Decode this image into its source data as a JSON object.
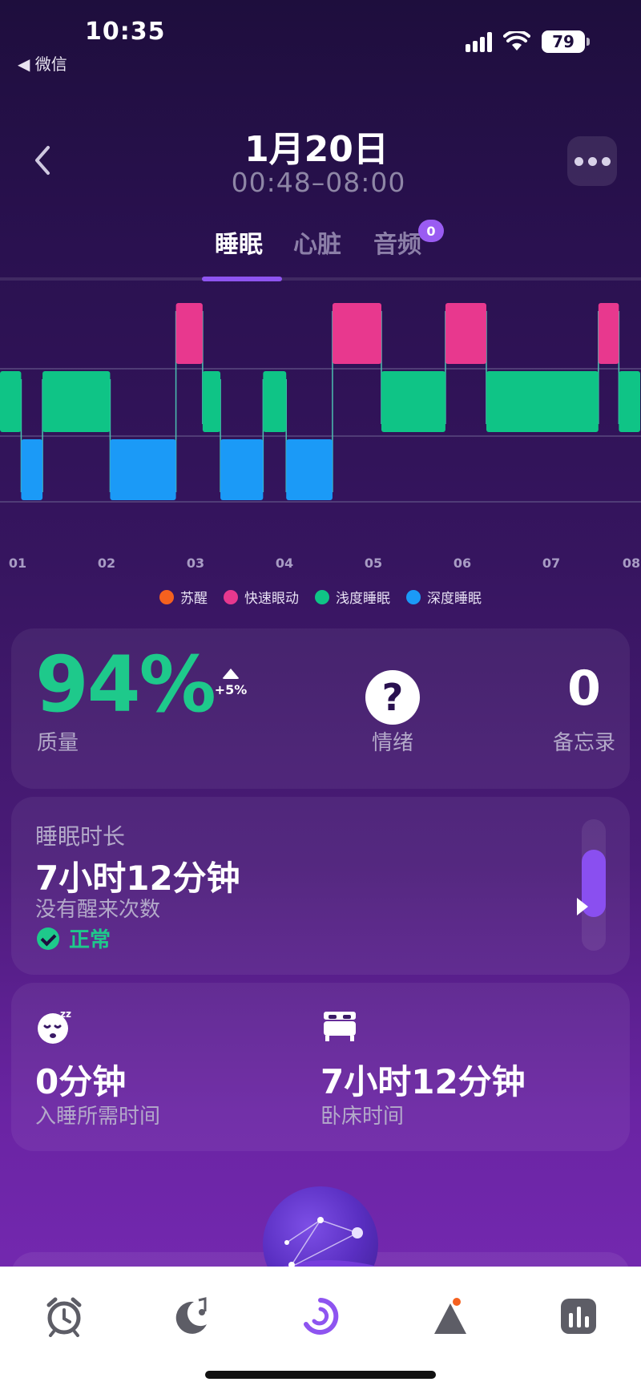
{
  "status_bar": {
    "time": "10:35",
    "back_app": "◀ 微信",
    "battery": "79"
  },
  "header": {
    "title": "1月20日",
    "subtitle": "00:48–08:00"
  },
  "tabs": [
    {
      "label": "睡眠",
      "active": true
    },
    {
      "label": "心脏",
      "active": false
    },
    {
      "label": "音频",
      "active": false,
      "badge": "0"
    }
  ],
  "chart_data": {
    "type": "hypnogram",
    "x_ticks": [
      "01",
      "02",
      "03",
      "04",
      "05",
      "06",
      "07",
      "08"
    ],
    "x_range_hours": [
      0.8,
      8.0
    ],
    "stages": [
      "rem",
      "light",
      "deep"
    ],
    "segments": [
      {
        "stage": "light",
        "start": 0.8,
        "end": 1.04
      },
      {
        "stage": "deep",
        "start": 1.04,
        "end": 1.28
      },
      {
        "stage": "light",
        "start": 1.28,
        "end": 2.04
      },
      {
        "stage": "deep",
        "start": 2.04,
        "end": 2.78
      },
      {
        "stage": "rem",
        "start": 2.78,
        "end": 3.08
      },
      {
        "stage": "light",
        "start": 3.08,
        "end": 3.28
      },
      {
        "stage": "deep",
        "start": 3.28,
        "end": 3.76
      },
      {
        "stage": "light",
        "start": 3.76,
        "end": 4.02
      },
      {
        "stage": "deep",
        "start": 4.02,
        "end": 4.54
      },
      {
        "stage": "rem",
        "start": 4.54,
        "end": 5.09
      },
      {
        "stage": "light",
        "start": 5.09,
        "end": 5.81
      },
      {
        "stage": "rem",
        "start": 5.81,
        "end": 6.27
      },
      {
        "stage": "light",
        "start": 6.27,
        "end": 7.53
      },
      {
        "stage": "rem",
        "start": 7.53,
        "end": 7.76
      },
      {
        "stage": "light",
        "start": 7.76,
        "end": 8.0
      }
    ],
    "legend": [
      {
        "key": "awake",
        "label": "苏醒",
        "color": "#f5611f"
      },
      {
        "key": "rem",
        "label": "快速眼动",
        "color": "#e8388e"
      },
      {
        "key": "light",
        "label": "浅度睡眠",
        "color": "#0fc486"
      },
      {
        "key": "deep",
        "label": "深度睡眠",
        "color": "#1b9af7"
      }
    ],
    "colors": {
      "rem": "#e8388e",
      "light": "#0fc486",
      "deep": "#1b9af7",
      "connector": "#4bbfb0",
      "grid": "#5a4a80",
      "tick": "#a89cc4"
    }
  },
  "quality": {
    "value": "94%",
    "label": "质量",
    "trend": "+5%"
  },
  "mood": {
    "icon": "?",
    "label": "情绪"
  },
  "notes": {
    "value": "0",
    "label": "备忘录"
  },
  "duration": {
    "label": "睡眠时长",
    "value": "7小时12分钟",
    "sub": "没有醒来次数",
    "status": "正常"
  },
  "latency": {
    "value": "0分钟",
    "label": "入睡所需时间"
  },
  "in_bed": {
    "value": "7小时12分钟",
    "label": "卧床时间"
  },
  "colors": {
    "accent": "#8e54f0",
    "good": "#1ec98b"
  }
}
